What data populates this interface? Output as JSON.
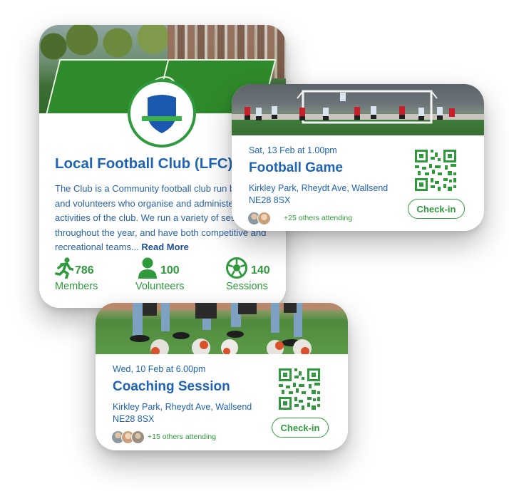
{
  "club": {
    "name": "Local Football Club (LFC)",
    "description": "The Club is a Community football club run by staff and volunteers who organise and administer the activities of the club. We run a variety of sessions throughout the year, and have both competitive and recreational teams...",
    "read_more_label": "Read More",
    "stats": [
      {
        "icon": "runner-icon",
        "value": "786",
        "label": "Members"
      },
      {
        "icon": "person-icon",
        "value": "100",
        "label": "Volunteers"
      },
      {
        "icon": "football-icon",
        "value": "140",
        "label": "Sessions"
      }
    ]
  },
  "events": [
    {
      "date": "Sat, 13 Feb at 1.00pm",
      "title": "Football Game",
      "location": "Kirkley Park, Rheydt Ave, Wallsend NE28 8SX",
      "attending": "+25 others attending",
      "checkin_label": "Check-in"
    },
    {
      "date": "Wed, 10 Feb at 6.00pm",
      "title": "Coaching Session",
      "location": "Kirkley Park, Rheydt Ave, Wallsend NE28 8SX",
      "attending": "+15 others attending",
      "checkin_label": "Check-in"
    }
  ],
  "colors": {
    "brand_blue": "#1f63b5",
    "brand_green": "#2e9a3c"
  }
}
